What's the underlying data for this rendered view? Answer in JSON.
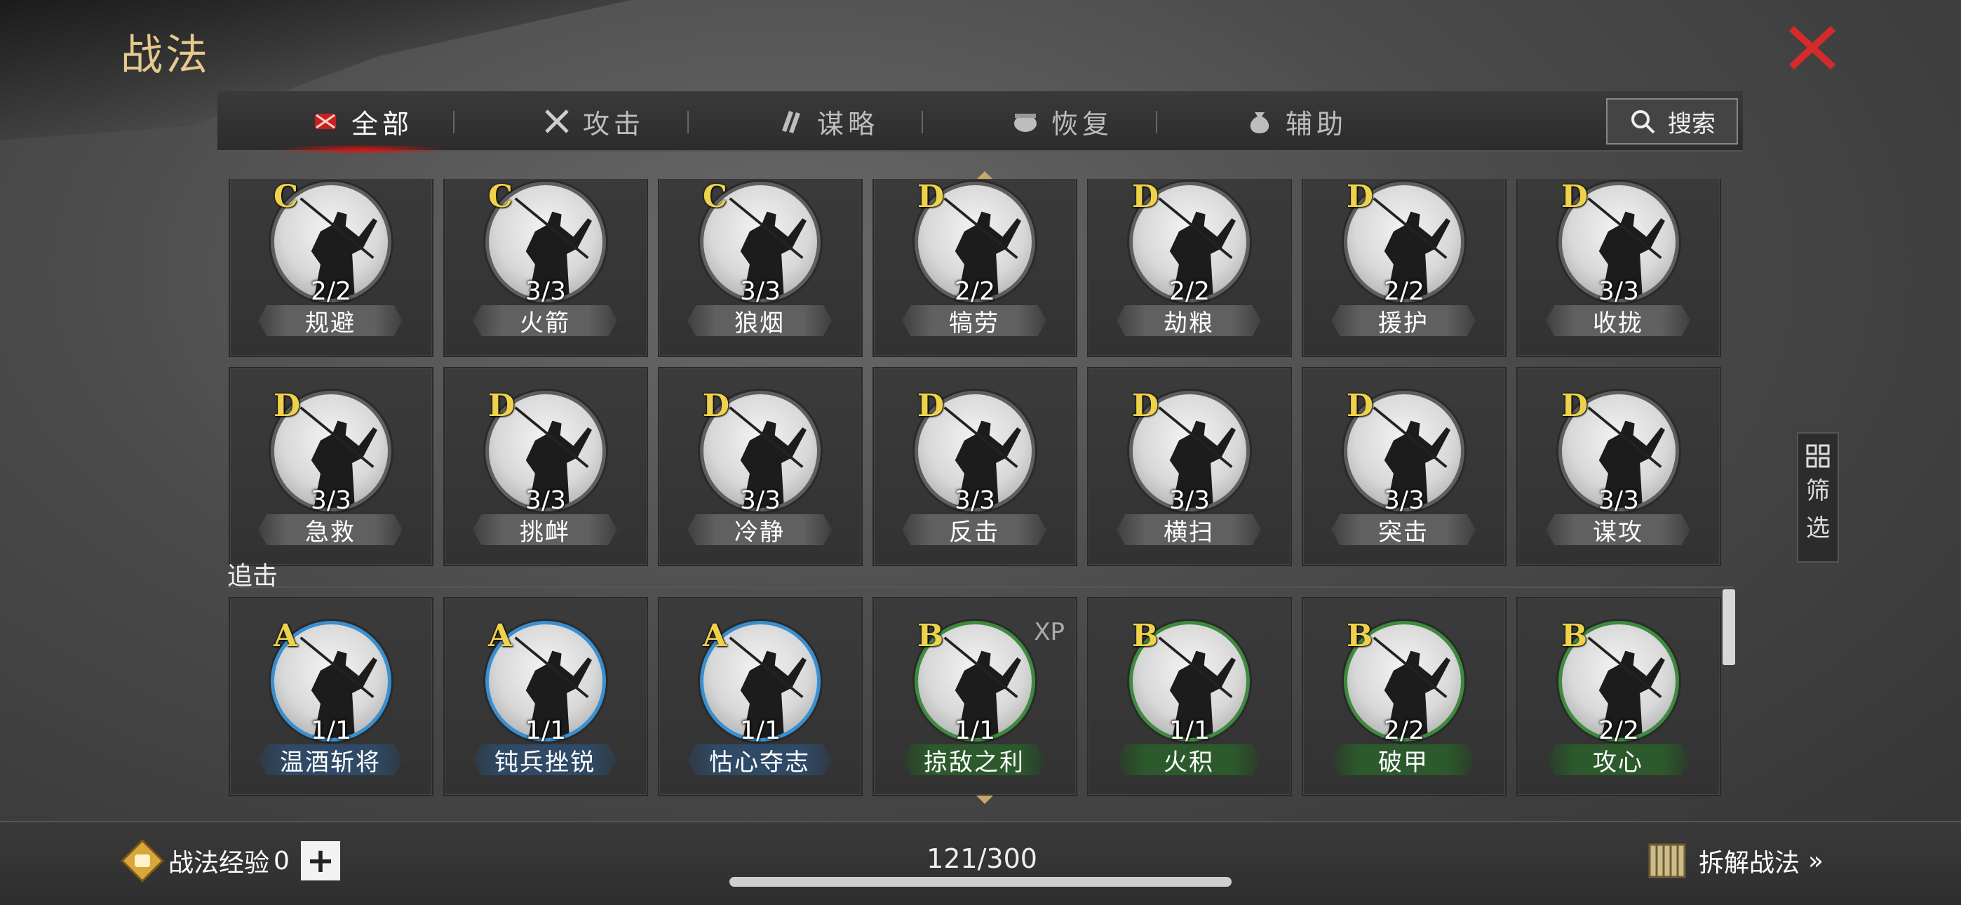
{
  "title": "战法",
  "tabs": [
    {
      "label": "全部",
      "icon": "all-tactics-icon",
      "active": true
    },
    {
      "label": "攻击",
      "icon": "crossed-swords-icon",
      "active": false
    },
    {
      "label": "谋略",
      "icon": "scroll-icon",
      "active": false
    },
    {
      "label": "恢复",
      "icon": "cauldron-icon",
      "active": false
    },
    {
      "label": "辅助",
      "icon": "pouch-icon",
      "active": false
    }
  ],
  "search_label": "搜索",
  "filter_label": [
    "筛",
    "选"
  ],
  "rows": [
    [
      {
        "grade": "C",
        "count": "2/2",
        "name": "规避",
        "tier": "grey"
      },
      {
        "grade": "C",
        "count": "3/3",
        "name": "火箭",
        "tier": "grey"
      },
      {
        "grade": "C",
        "count": "3/3",
        "name": "狼烟",
        "tier": "grey"
      },
      {
        "grade": "D",
        "count": "2/2",
        "name": "犒劳",
        "tier": "grey"
      },
      {
        "grade": "D",
        "count": "2/2",
        "name": "劫粮",
        "tier": "grey"
      },
      {
        "grade": "D",
        "count": "2/2",
        "name": "援护",
        "tier": "grey"
      },
      {
        "grade": "D",
        "count": "3/3",
        "name": "收拢",
        "tier": "grey"
      }
    ],
    [
      {
        "grade": "D",
        "count": "3/3",
        "name": "急救",
        "tier": "grey"
      },
      {
        "grade": "D",
        "count": "3/3",
        "name": "挑衅",
        "tier": "grey"
      },
      {
        "grade": "D",
        "count": "3/3",
        "name": "冷静",
        "tier": "grey"
      },
      {
        "grade": "D",
        "count": "3/3",
        "name": "反击",
        "tier": "grey"
      },
      {
        "grade": "D",
        "count": "3/3",
        "name": "横扫",
        "tier": "grey"
      },
      {
        "grade": "D",
        "count": "3/3",
        "name": "突击",
        "tier": "grey"
      },
      {
        "grade": "D",
        "count": "3/3",
        "name": "谋攻",
        "tier": "grey"
      }
    ]
  ],
  "section_label": "追击",
  "section_row": [
    {
      "grade": "A",
      "count": "1/1",
      "name": "温酒斩将",
      "tier": "blue"
    },
    {
      "grade": "A",
      "count": "1/1",
      "name": "钝兵挫锐",
      "tier": "blue"
    },
    {
      "grade": "A",
      "count": "1/1",
      "name": "怙心夺志",
      "tier": "blue"
    },
    {
      "grade": "B",
      "count": "1/1",
      "name": "掠敌之利",
      "tier": "green",
      "xp": "XP"
    },
    {
      "grade": "B",
      "count": "1/1",
      "name": "火积",
      "tier": "green"
    },
    {
      "grade": "B",
      "count": "2/2",
      "name": "破甲",
      "tier": "green"
    },
    {
      "grade": "B",
      "count": "2/2",
      "name": "攻心",
      "tier": "green"
    }
  ],
  "bottom": {
    "exp_label": "战法经验",
    "exp_value": "0",
    "plus": "+",
    "capacity": "121/300",
    "dismantle_label": "拆解战法",
    "dismantle_arrow": "»"
  },
  "colors": {
    "title": "#e6c98c",
    "close": "#d42a2a",
    "grade": "#f0d24a",
    "tab_active": "#cc1111"
  }
}
